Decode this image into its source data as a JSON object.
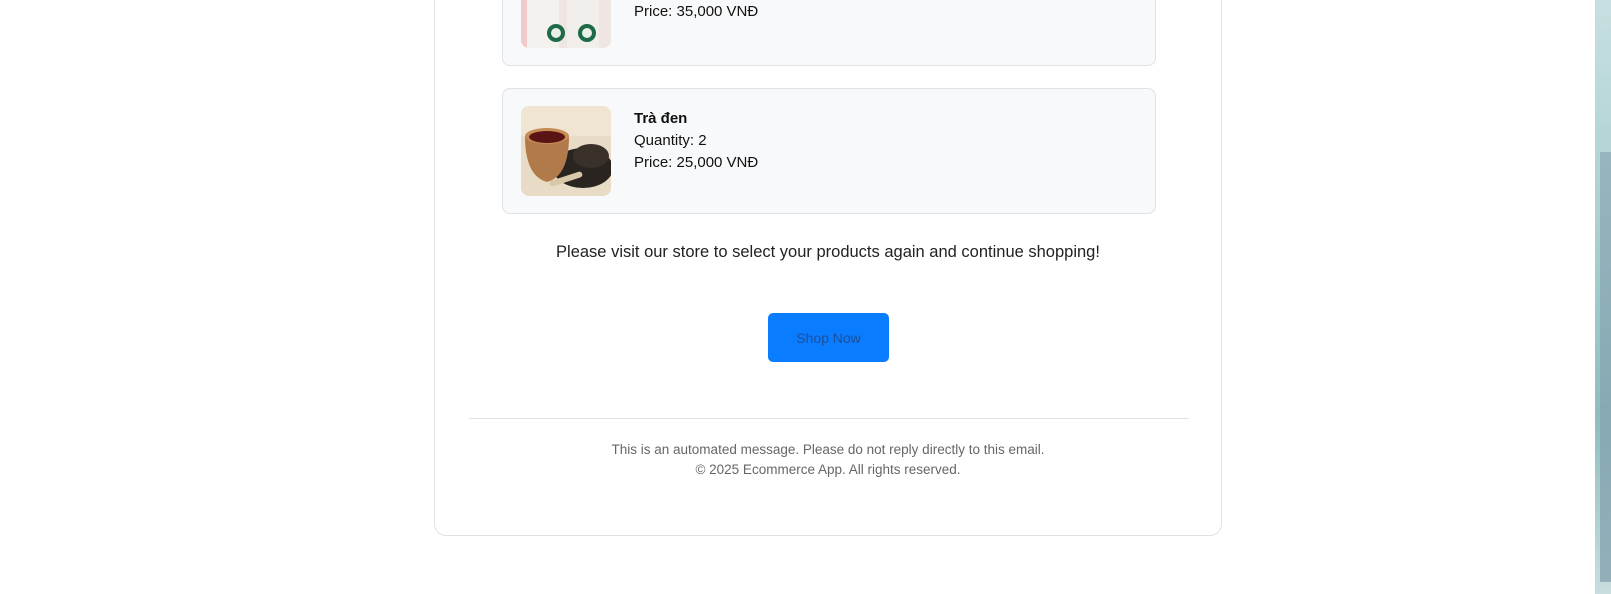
{
  "items": [
    {
      "name": "",
      "quantity": "",
      "price": "Price: 35,000 VNĐ",
      "image_icon": "starbucks-cups-image"
    },
    {
      "name": "Trà đen",
      "quantity": "Quantity: 2",
      "price": "Price: 25,000 VNĐ",
      "image_icon": "black-tea-image"
    }
  ],
  "message": "Please visit our store to select your products again and continue shopping!",
  "shop_button": {
    "label": "Shop Now",
    "color": "#0a7cff"
  },
  "footer": {
    "line1": "This is an automated message. Please do not reply directly to this email.",
    "line2": "© 2025 Ecommerce App. All rights reserved."
  }
}
